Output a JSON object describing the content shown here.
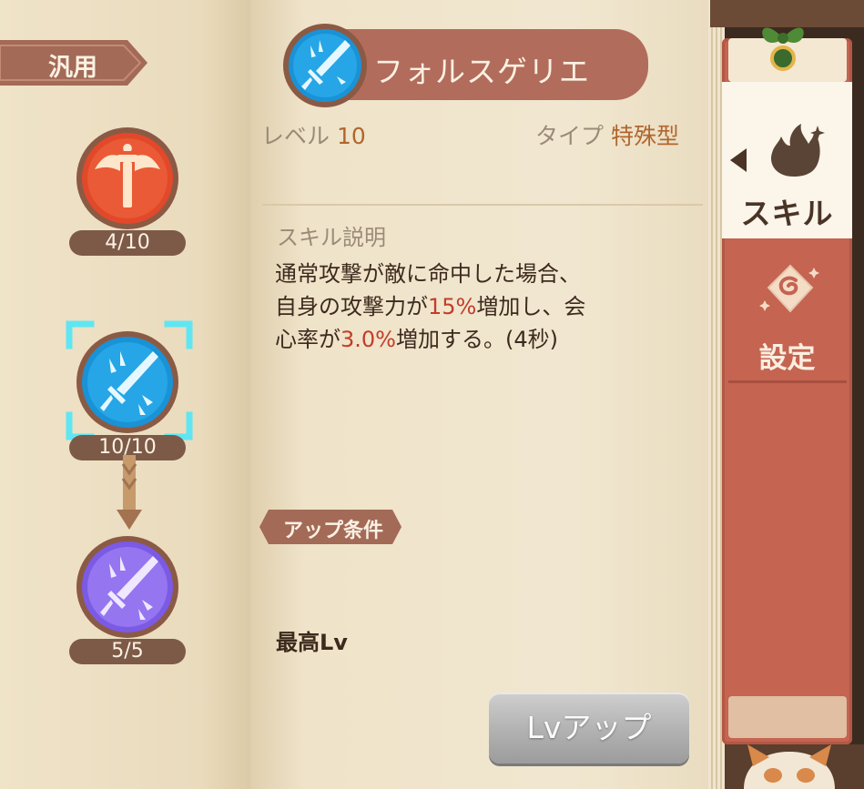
{
  "category": {
    "label": "汎用"
  },
  "skill_tree": [
    {
      "id": "skill-1",
      "count": "4/10",
      "color": "red",
      "icon": "winged-sword-icon"
    },
    {
      "id": "skill-2",
      "count": "10/10",
      "color": "blue",
      "icon": "sword-shards-icon",
      "selected": true
    },
    {
      "id": "skill-3",
      "count": "5/5",
      "color": "purple",
      "icon": "sword-shards-icon"
    }
  ],
  "detail": {
    "name": "フォルスゲリエ",
    "level_label": "レベル",
    "level_value": "10",
    "type_label": "タイプ",
    "type_value": "特殊型",
    "desc_title": "スキル説明",
    "desc_line1": "通常攻撃が敵に命中した場合、",
    "desc_line2a": "自身の攻撃力が",
    "desc_line2b": "15%",
    "desc_line2c": "増加し、会",
    "desc_line3a": "心率が",
    "desc_line3b": "3.0%",
    "desc_line3c": "増加する。(4秒)",
    "condition_label": "アップ条件",
    "condition_value": "最高Lv",
    "levelup_button": "Lvアップ"
  },
  "tabs": [
    {
      "label": "スキル",
      "icon": "skill-flame-icon",
      "active": true
    },
    {
      "label": "設定",
      "icon": "settings-spiral-icon",
      "active": false
    }
  ],
  "colors": {
    "accent_red": "#c23d2a",
    "title_bar": "#b26c5c",
    "tab_strip": "#c46451",
    "highlight_orange": "#b0662e",
    "selector_cyan": "#5fe6f2"
  }
}
